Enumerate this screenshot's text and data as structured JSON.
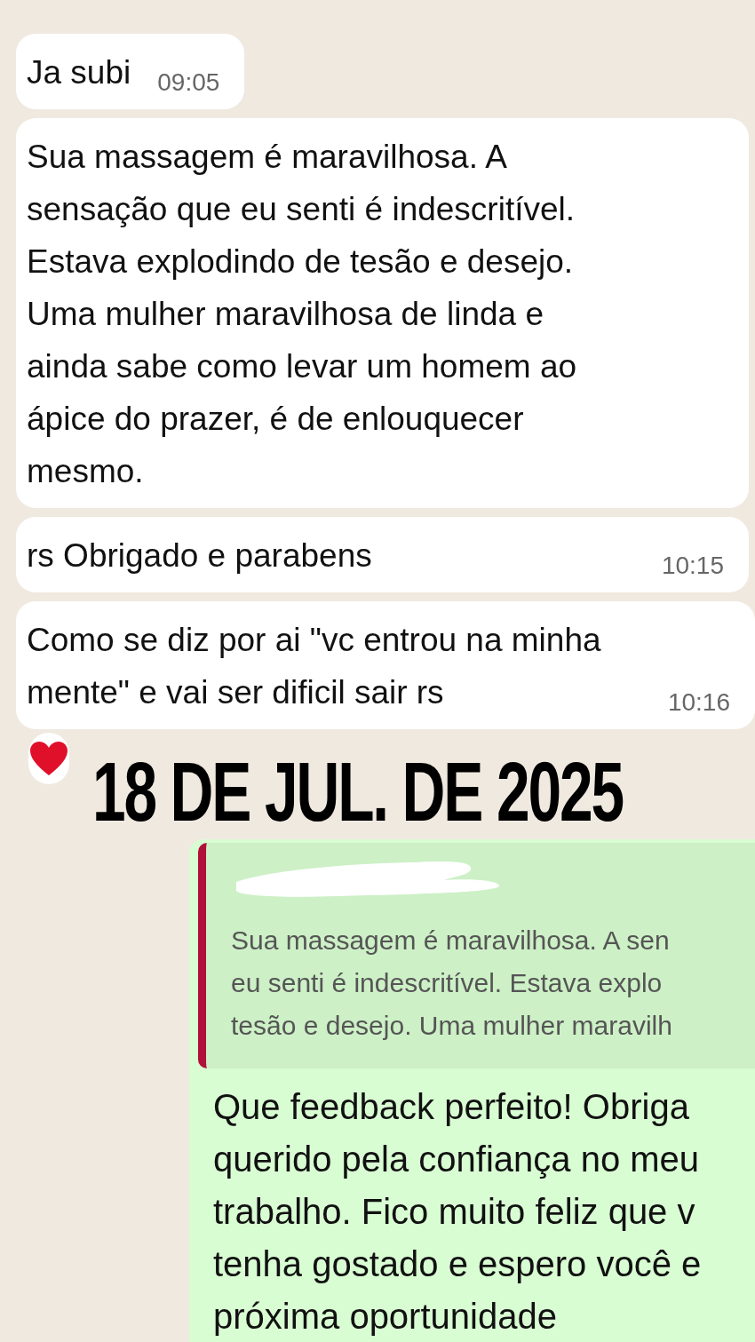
{
  "messages": [
    {
      "kind": "received",
      "text": "Ja subi",
      "time": "09:05"
    },
    {
      "kind": "received",
      "text": "Sua massagem é maravilhosa. A\nsensação que eu senti é indescritível.\nEstava explodindo de tesão e desejo.\nUma mulher maravilhosa de linda e\nainda sabe como levar um homem ao\nápice do prazer, é de enlouquecer\nmesmo."
    },
    {
      "kind": "received",
      "text": "rs Obrigado e parabens",
      "time": "10:15"
    },
    {
      "kind": "received",
      "text": "Como se diz por ai \"vc entrou na minha\nmente\" e vai ser dificil sair rs",
      "time": "10:16"
    }
  ],
  "date_label": "18 DE JUL. DE 2025",
  "reply": {
    "quote": "Sua massagem é maravilhosa. A sen\neu senti é indescritível. Estava explo\ntesão e desejo. Uma mulher maravilh",
    "text": "Que feedback perfeito! Obriga\nquerido pela confiança no meu\ntrabalho. Fico muito feliz que v\ntenha gostado e espero você e\npróxima oportunidade"
  }
}
